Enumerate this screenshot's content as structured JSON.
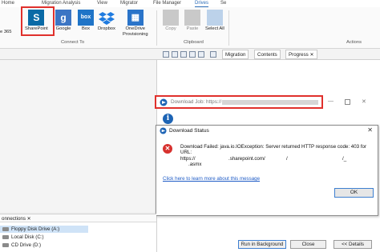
{
  "ribbon_tabs": [
    {
      "label": "Home"
    },
    {
      "label": "Migration Analysis"
    },
    {
      "label": "View"
    },
    {
      "label": "Migrator"
    },
    {
      "label": "File Manager"
    },
    {
      "label": "Drives"
    },
    {
      "label": "Se"
    }
  ],
  "ribbon": {
    "partial_label": "e 365",
    "connect_buttons": [
      {
        "label": "SharePoint",
        "icon": "sharepoint-icon"
      },
      {
        "label": "Google",
        "icon": "google-icon"
      },
      {
        "label": "Box",
        "icon": "box-icon"
      },
      {
        "label": "Dropbox",
        "icon": "dropbox-icon"
      },
      {
        "label": "OneDrive",
        "label2": "Provisioning",
        "icon": "onedrive-icon"
      }
    ],
    "clipboard_buttons": [
      {
        "label": "Copy"
      },
      {
        "label": "Paste"
      },
      {
        "label": "Select All"
      }
    ],
    "groups": {
      "connect": "Connect To",
      "clipboard": "Clipboard",
      "actions": "Actions"
    }
  },
  "panel_tabs": {
    "migration": "Migration",
    "contents": "Contents",
    "progress": "Progress"
  },
  "job_window": {
    "title": "Download Job: https://"
  },
  "dialog": {
    "title": "Download Status",
    "line1": "Download Failed: java.io.IOException: Server returned HTTP response code: 403 for",
    "line2": "URL:",
    "line3a": "https://",
    "line3b": ".sharepoint.com/",
    "line3c": "/",
    "line3d": "/_",
    "line4": ".asmx",
    "link": "Click here to learn more about this message",
    "ok": "OK"
  },
  "bottom_buttons": {
    "background": "Run in Background",
    "close": "Close",
    "details": "<< Details"
  },
  "connections": {
    "header": "onnections",
    "drives": [
      {
        "label": "Floppy Disk Drive (A:)"
      },
      {
        "label": "Local Disk (C:)"
      },
      {
        "label": "CD Drive (D:)"
      }
    ]
  },
  "colors": {
    "highlight_red": "#e0302c",
    "accent_blue": "#2b6cb8",
    "link_blue": "#1e5bc6"
  }
}
